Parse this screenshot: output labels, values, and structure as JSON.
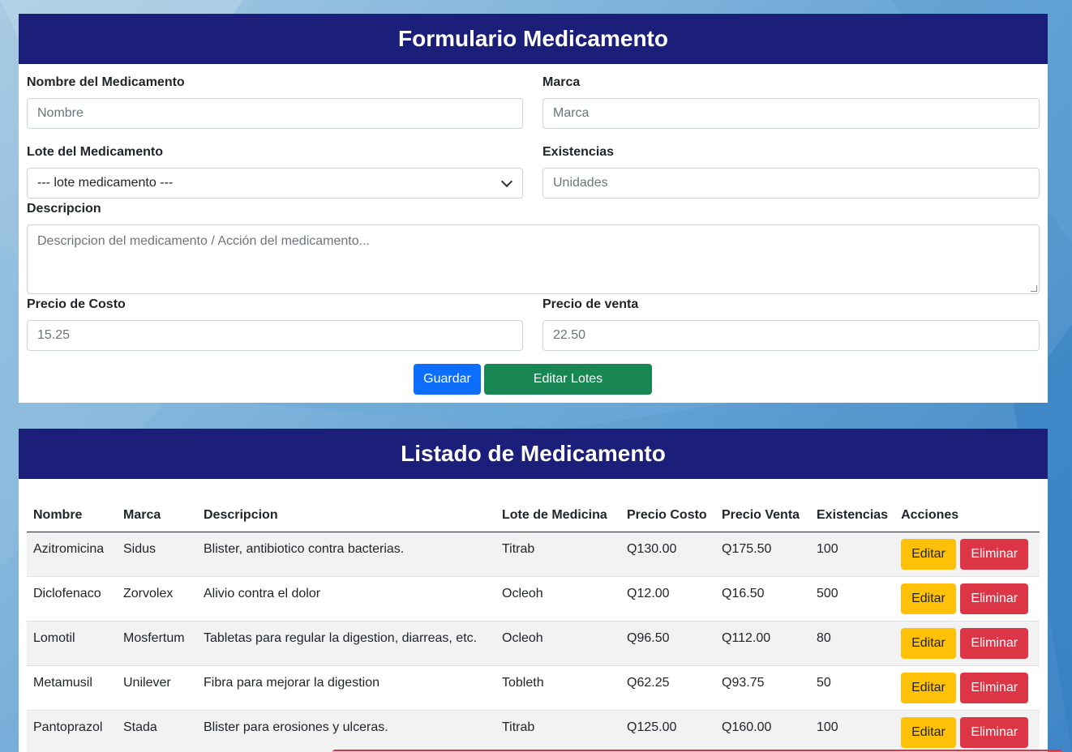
{
  "form": {
    "title": "Formulario Medicamento",
    "nombre_label": "Nombre del Medicamento",
    "nombre_placeholder": "Nombre",
    "marca_label": "Marca",
    "marca_placeholder": "Marca",
    "lote_label": "Lote del Medicamento",
    "lote_value": "--- lote medicamento ---",
    "existencias_label": "Existencias",
    "existencias_placeholder": "Unidades",
    "descripcion_label": "Descripcion",
    "descripcion_placeholder": "Descripcion del medicamento / Acción del medicamento...",
    "costo_label": "Precio de Costo",
    "costo_value": "15.25",
    "venta_label": "Precio de venta",
    "venta_value": "22.50",
    "save_label": "Guardar",
    "edit_lotes_label": "Editar Lotes"
  },
  "list": {
    "title": "Listado de Medicamento",
    "columns": [
      "Nombre",
      "Marca",
      "Descripcion",
      "Lote de Medicina",
      "Precio Costo",
      "Precio Venta",
      "Existencias",
      "Acciones"
    ],
    "edit_label": "Editar",
    "delete_label": "Eliminar",
    "rows": [
      {
        "nombre": "Azitromicina",
        "marca": "Sidus",
        "descripcion": "Blister, antibiotico contra bacterias.",
        "lote": "Titrab",
        "costo": "Q130.00",
        "venta": "Q175.50",
        "existencias": "100"
      },
      {
        "nombre": "Diclofenaco",
        "marca": "Zorvolex",
        "descripcion": "Alivio contra el dolor",
        "lote": "Ocleoh",
        "costo": "Q12.00",
        "venta": "Q16.50",
        "existencias": "500"
      },
      {
        "nombre": "Lomotil",
        "marca": "Mosfertum",
        "descripcion": "Tabletas para regular la digestion, diarreas, etc.",
        "lote": "Ocleoh",
        "costo": "Q96.50",
        "venta": "Q112.00",
        "existencias": "80"
      },
      {
        "nombre": "Metamusil",
        "marca": "Unilever",
        "descripcion": "Fibra para mejorar la digestion",
        "lote": "Tobleth",
        "costo": "Q62.25",
        "venta": "Q93.75",
        "existencias": "50"
      },
      {
        "nombre": "Pantoprazol",
        "marca": "Stada",
        "descripcion": "Blister para erosiones y ulceras.",
        "lote": "Titrab",
        "costo": "Q125.00",
        "venta": "Q160.00",
        "existencias": "100"
      }
    ]
  },
  "colors": {
    "header_bg": "#1b1f7a",
    "primary": "#0d6efd",
    "success": "#198754",
    "warning": "#ffc107",
    "danger": "#dc3545"
  }
}
